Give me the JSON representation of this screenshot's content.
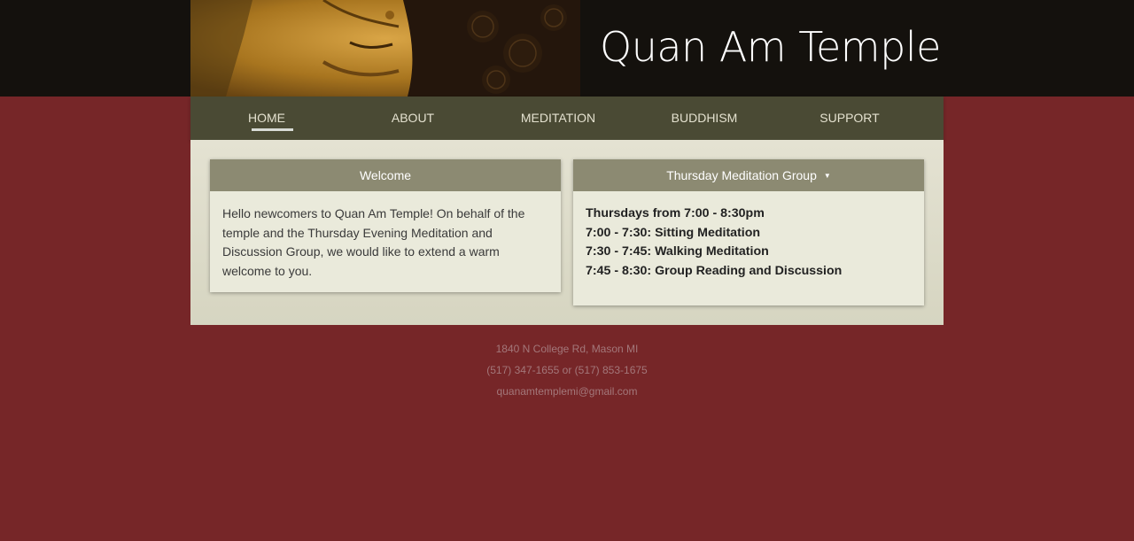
{
  "site": {
    "title": "Quan Am Temple",
    "hero_image": "buddha-face-image"
  },
  "nav": {
    "items": [
      {
        "label": "HOME",
        "active": true
      },
      {
        "label": "ABOUT"
      },
      {
        "label": "MEDITATION"
      },
      {
        "label": "BUDDHISM"
      },
      {
        "label": "SUPPORT"
      }
    ]
  },
  "welcome": {
    "title": "Welcome",
    "body": "Hello newcomers to Quan Am Temple! On behalf of the temple and the Thursday Evening Meditation and Discussion Group, we would like to extend a warm welcome to you."
  },
  "thursday": {
    "title": "Thursday Meditation Group",
    "caret_icon": "triangle-down-icon",
    "schedule": [
      "Thursdays from 7:00 - 8:30pm",
      "7:00 - 7:30: Sitting Meditation",
      "7:30 - 7:45: Walking Meditation",
      "7:45 - 8:30: Group Reading and Discussion"
    ]
  },
  "footer": {
    "address": "1840 N College Rd, Mason MI",
    "phones": "(517) 347-1655 or (517) 853-1675",
    "email": "quanamtemplemi@gmail.com"
  },
  "colors": {
    "background": "#762628",
    "nav": "#4a4a34",
    "card_header": "#8c8a72",
    "card_body": "#eaeadb"
  }
}
